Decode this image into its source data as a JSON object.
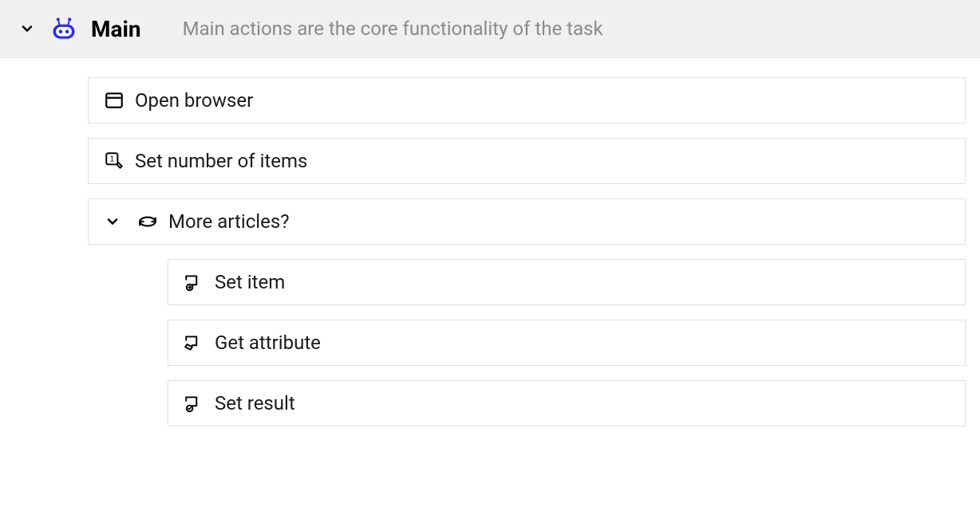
{
  "header": {
    "title": "Main",
    "description": "Main actions are the core functionality of the task"
  },
  "actions": {
    "open_browser": "Open browser",
    "set_number_items": "Set number of items",
    "more_articles": "More articles?",
    "set_item": "Set item",
    "get_attribute": "Get attribute",
    "set_result": "Set result"
  }
}
